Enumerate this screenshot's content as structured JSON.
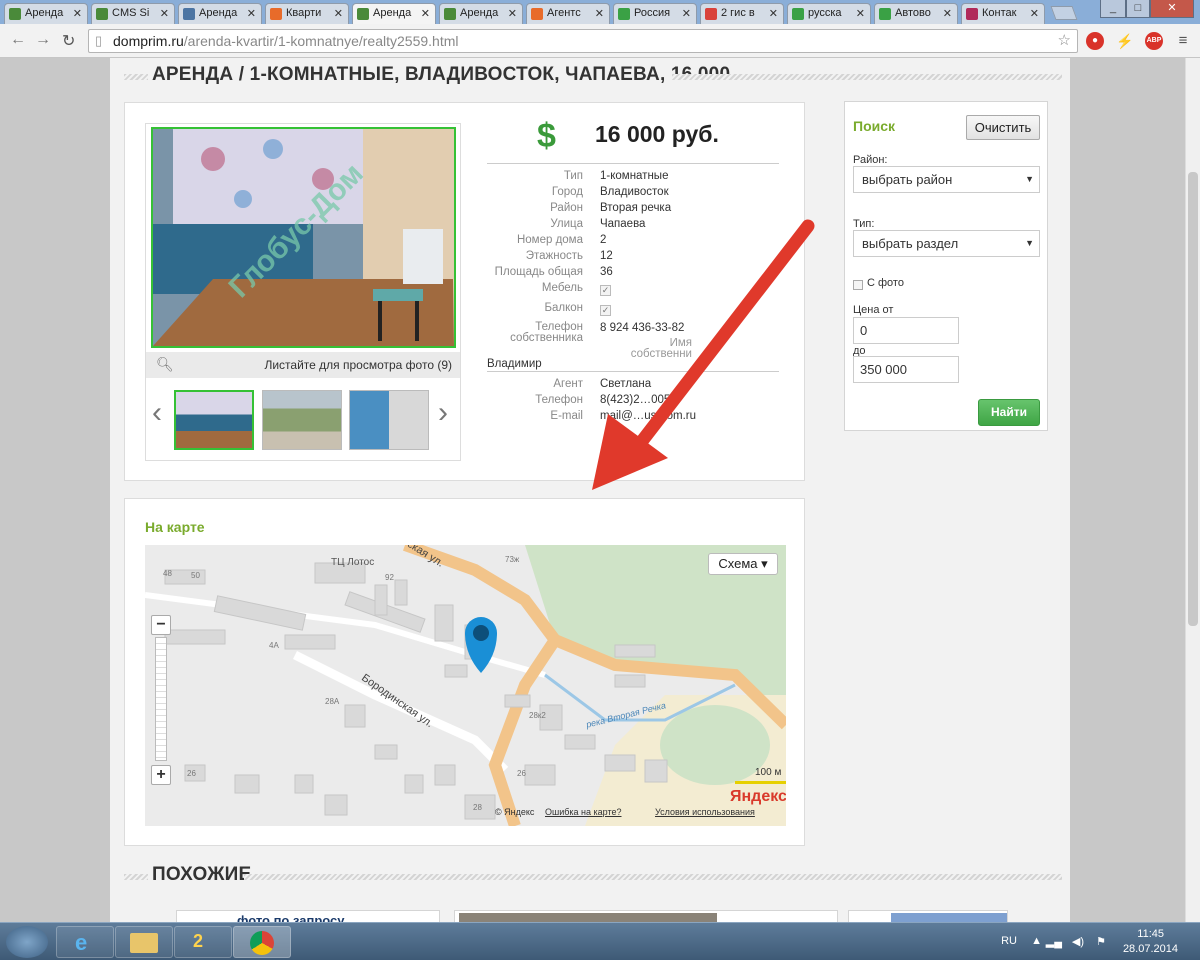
{
  "browser": {
    "tabs": [
      {
        "label": "Аренда",
        "fav": "#4a8a3a"
      },
      {
        "label": "CMS Si",
        "fav": "#4a8a3a"
      },
      {
        "label": "Аренда",
        "fav": "#4c75a3"
      },
      {
        "label": "Кварти",
        "fav": "#e86b2a"
      },
      {
        "label": "Аренда",
        "fav": "#4a8a3a",
        "active": true
      },
      {
        "label": "Аренда",
        "fav": "#4a8a3a"
      },
      {
        "label": "Агентс",
        "fav": "#e86b2a"
      },
      {
        "label": "Россия",
        "fav": "#3aa145"
      },
      {
        "label": "2 гис в",
        "fav": "#d9423b"
      },
      {
        "label": "русска",
        "fav": "#3aa145"
      },
      {
        "label": "Автово",
        "fav": "#3aa145"
      },
      {
        "label": "Контак",
        "fav": "#b02a5a"
      }
    ],
    "url_host": "domprim.ru",
    "url_path": "/arenda-kvartir/1-komnatnye/realty2559.html",
    "ext_abp": "ABP"
  },
  "page": {
    "title": "Аренда / 1-комнатные, Владивосток, Чапаева, 16 000",
    "photo_watermark": "Глобус-Дом",
    "photo_hint": "Листайте для просмотра фото (9)",
    "price": "16 000 руб.",
    "details": [
      {
        "k": "Тип",
        "v": "1-комнатные"
      },
      {
        "k": "Город",
        "v": "Владивосток"
      },
      {
        "k": "Район",
        "v": "Вторая речка"
      },
      {
        "k": "Улица",
        "v": "Чапаева"
      },
      {
        "k": "Номер дома",
        "v": "2"
      },
      {
        "k": "Этажность",
        "v": "12"
      },
      {
        "k": "Площадь общая",
        "v": "36"
      }
    ],
    "furniture_label": "Мебель",
    "balcony_label": "Балкон",
    "phone_owner_label": "Телефон собственника",
    "phone_owner_value": "8 924 436-33-82",
    "owner_name_label": "Имя собственни",
    "owner_name": "Владимир",
    "agent_label": "Агент",
    "agent_value": "Светлана",
    "phone_label": "Телефон",
    "phone_value": "8(423)2…005",
    "email_label": "E-mail",
    "email_value": "mail@…us-dom.ru"
  },
  "search": {
    "title": "Поиск",
    "clear": "Очистить",
    "district_label": "Район:",
    "district_value": "выбрать район",
    "type_label": "Тип:",
    "type_value": "выбрать раздел",
    "photo_label": "С фото",
    "price_from_label": "Цена от",
    "price_from": "0",
    "price_to_label": "до",
    "price_to": "350 000",
    "submit": "Найти"
  },
  "map": {
    "heading": "На карте",
    "scheme_button": "Схема",
    "labels": {
      "mall": "ТЦ Лотос",
      "street1": "Бородинская ул.",
      "street2": "…ская ул.",
      "river": "река Вторая Речка",
      "scale": "100 м",
      "brand": "Яндекс",
      "error": "Ошибка на карте?",
      "terms": "Условия использования",
      "copyright": "© Яндекс"
    },
    "house_numbers": [
      "48",
      "50",
      "92",
      "73ж",
      "4А",
      "28А",
      "28к2",
      "26",
      "26",
      "28"
    ]
  },
  "similar": {
    "title": "Похожие",
    "card_text": "фото по запросу"
  },
  "taskbar": {
    "lang": "RU",
    "time": "11:45",
    "date": "28.07.2014"
  }
}
